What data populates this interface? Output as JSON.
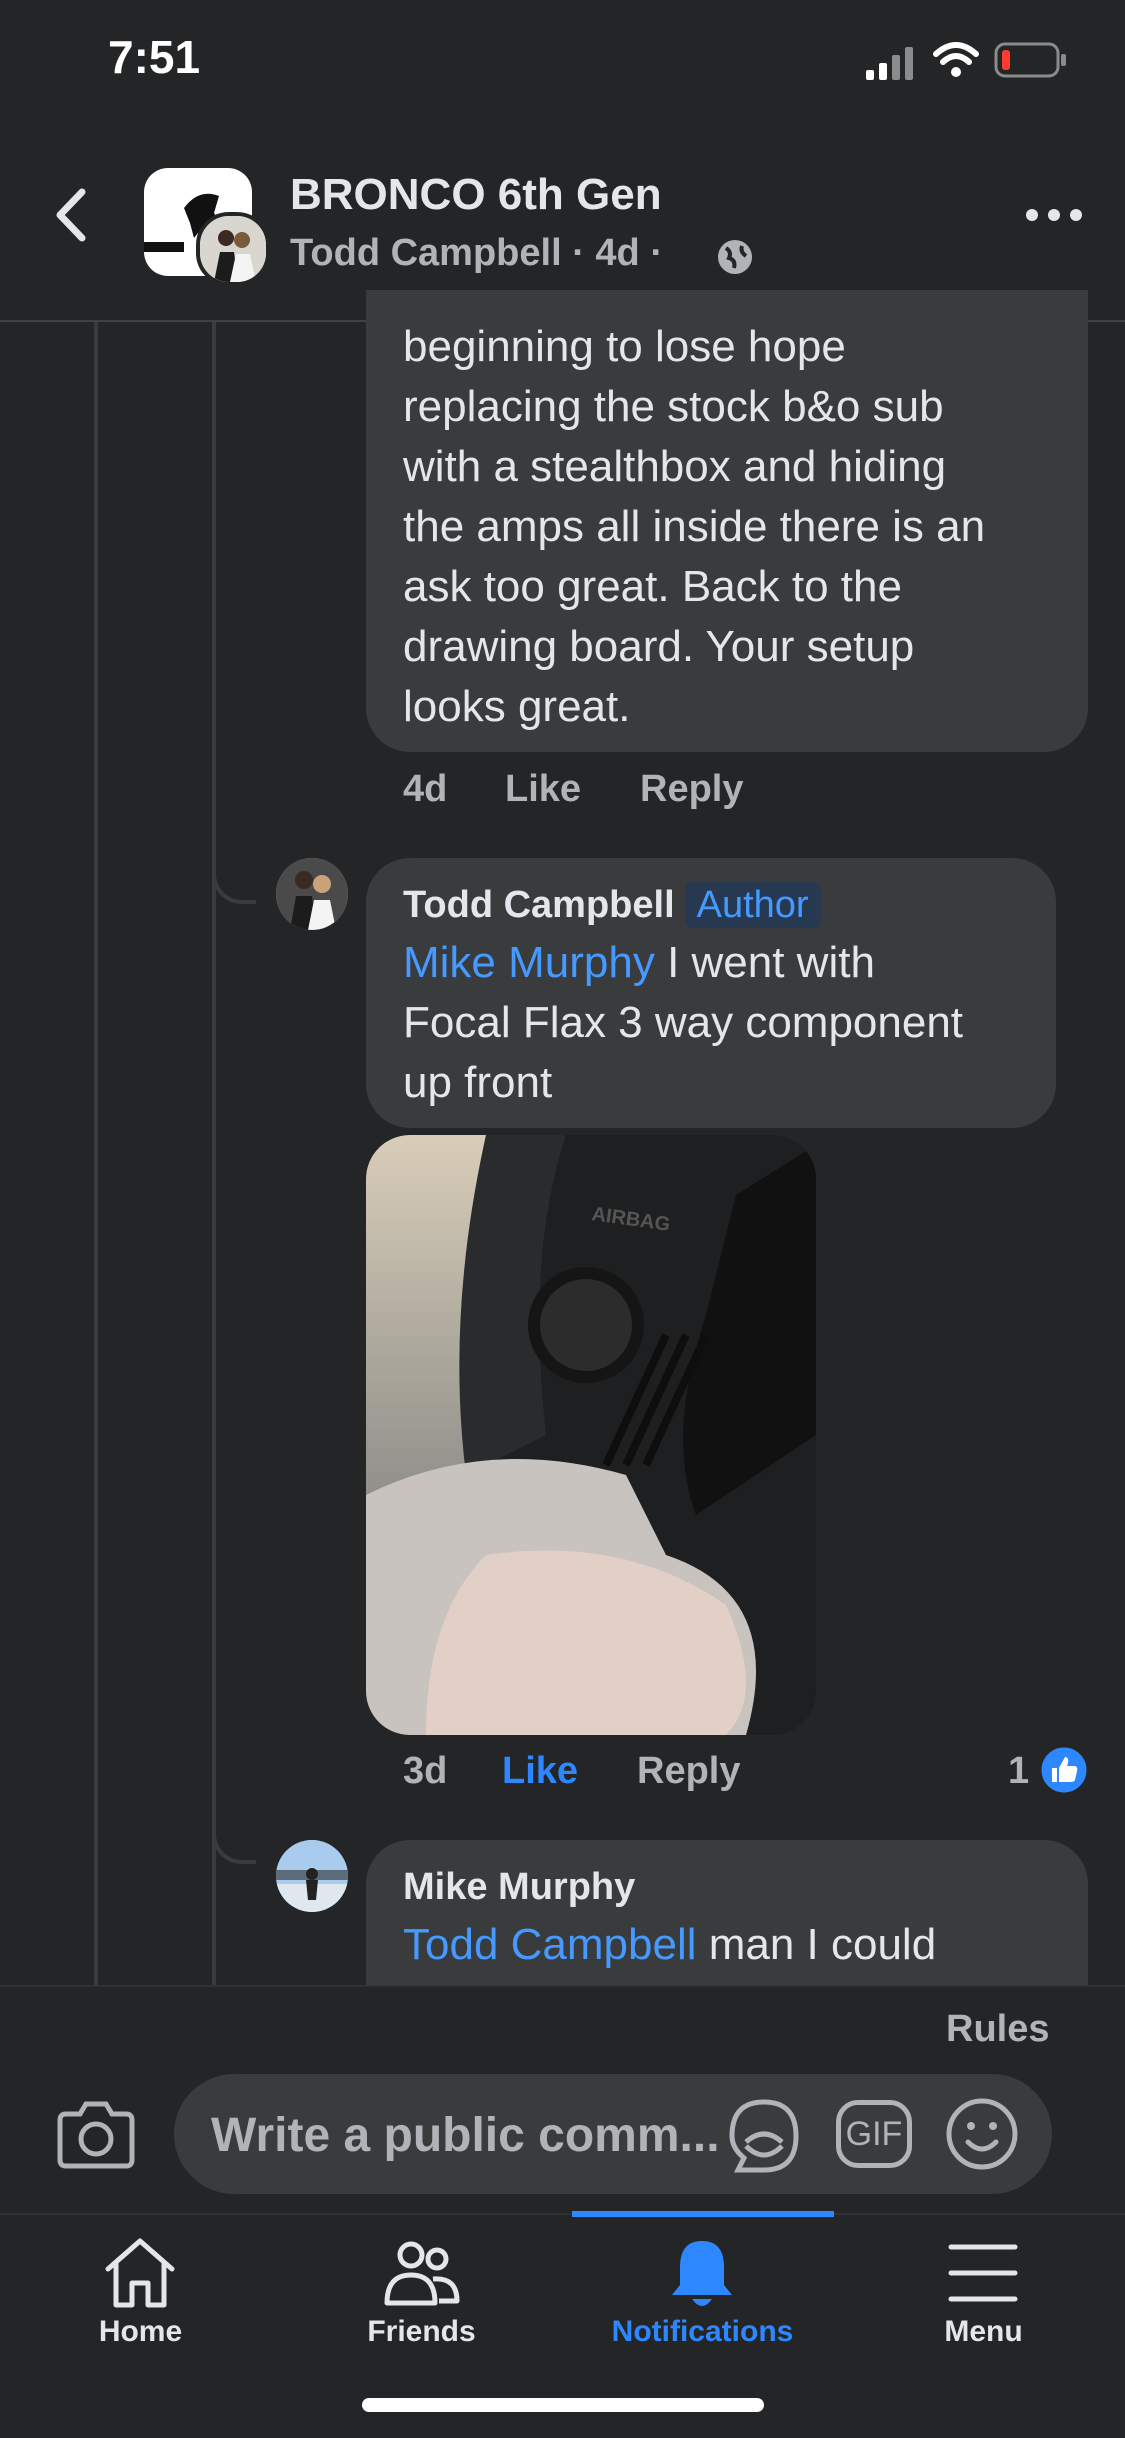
{
  "status_bar": {
    "time": "7:51"
  },
  "header": {
    "group_name": "BRONCO 6th Gen",
    "poster": "Todd Campbell",
    "sep1": "·",
    "age": "4d",
    "sep2": "·"
  },
  "comments": [
    {
      "text": "beginning to lose hope replacing the stock b&o sub with a stealthbox and hiding the amps all inside there is an ask too great. Back to the drawing board. Your setup looks great.",
      "lines": [
        "beginning to lose hope",
        "replacing the stock b&o sub",
        "with a stealthbox and hiding",
        "the amps all inside there is an",
        "ask too great. Back to the",
        "drawing board. Your setup",
        "looks great."
      ],
      "time": "4d",
      "like": "Like",
      "reply": "Reply"
    },
    {
      "author": "Todd Campbell",
      "badge": "Author",
      "mention": "Mike Murphy",
      "line1": " I went with",
      "line2": "Focal Flax 3 way component",
      "line3": "up front",
      "time": "3d",
      "like": "Like",
      "reply": "Reply",
      "reaction_count": "1",
      "photo_text": "AIRBAG"
    },
    {
      "author": "Mike Murphy",
      "mention": "Todd Campbell",
      "text": " man I could"
    }
  ],
  "composer": {
    "rules": "Rules",
    "placeholder": "Write a public comm...",
    "gif": "GIF"
  },
  "tabs": [
    {
      "label": "Home",
      "icon": "home-icon",
      "active": false
    },
    {
      "label": "Friends",
      "icon": "friends-icon",
      "active": false
    },
    {
      "label": "Notifications",
      "icon": "bell-icon",
      "active": true
    },
    {
      "label": "Menu",
      "icon": "menu-icon",
      "active": false
    }
  ],
  "colors": {
    "background": "#242526",
    "bubble": "#3a3b3c",
    "accent": "#2d88ff",
    "mention": "#4599ff"
  }
}
